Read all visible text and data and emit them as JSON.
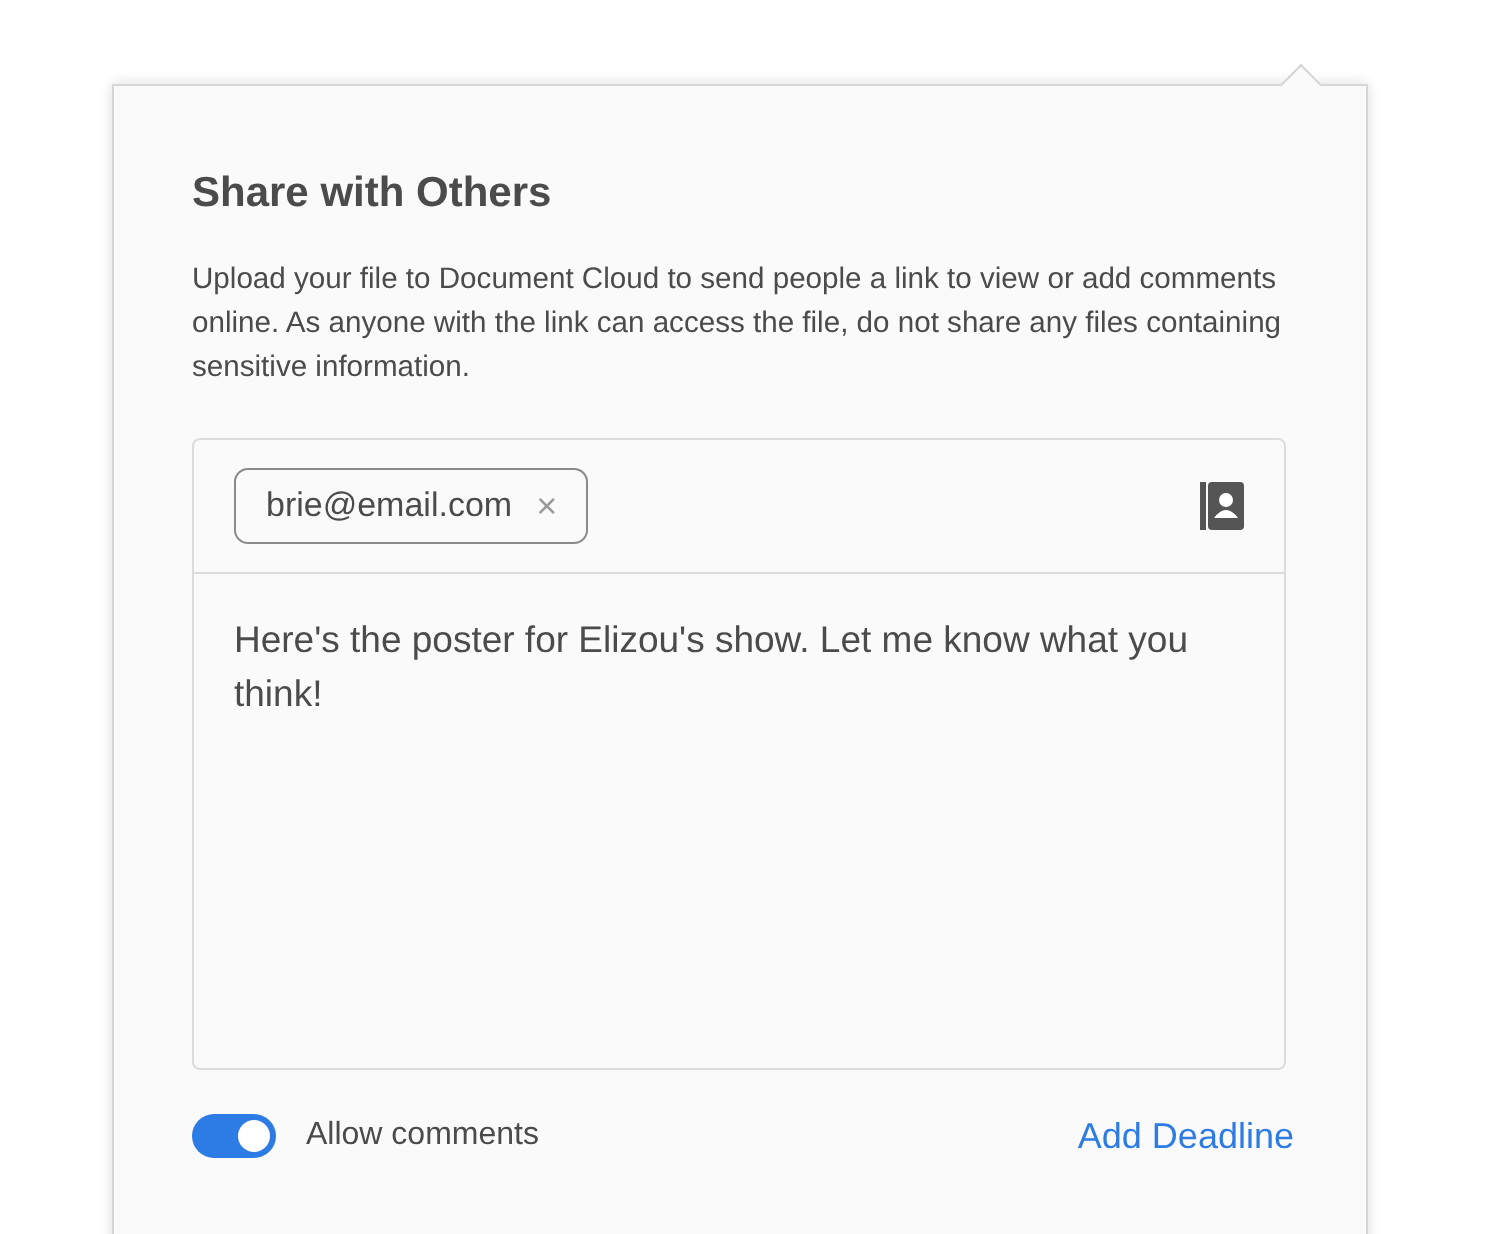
{
  "dialog": {
    "title": "Share with Others",
    "description": "Upload your file to Document Cloud to send people a link to view or add comments online. As anyone with the link can access the file, do not share any files containing sensitive information."
  },
  "recipients": [
    {
      "email": "brie@email.com",
      "remove": "×"
    }
  ],
  "message": {
    "value": "Here's the poster for Elizou's show. Let me know what you think!"
  },
  "allow_comments": {
    "label": "Allow comments",
    "on": true
  },
  "add_deadline": "Add Deadline"
}
